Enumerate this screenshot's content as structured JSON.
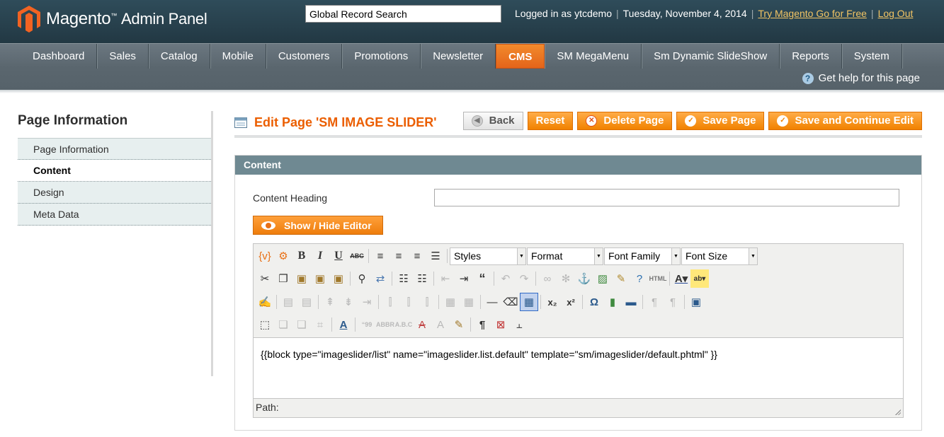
{
  "header": {
    "logo_text": "Magento",
    "logo_sub": "Admin Panel",
    "search_value": "Global Record Search",
    "logged_in": "Logged in as ytcdemo",
    "date": "Tuesday, November 4, 2014",
    "try_link": "Try Magento Go for Free",
    "logout_link": "Log Out"
  },
  "nav": {
    "items": [
      "Dashboard",
      "Sales",
      "Catalog",
      "Mobile",
      "Customers",
      "Promotions",
      "Newsletter",
      "CMS",
      "SM MegaMenu",
      "Sm Dynamic SlideShow",
      "Reports",
      "System"
    ],
    "active": "CMS",
    "help": "Get help for this page"
  },
  "sidebar": {
    "title": "Page Information",
    "tabs": [
      "Page Information",
      "Content",
      "Design",
      "Meta Data"
    ],
    "active_tab": "Content"
  },
  "page": {
    "title": "Edit Page 'SM IMAGE SLIDER'",
    "buttons": {
      "back": "Back",
      "reset": "Reset",
      "delete": "Delete Page",
      "save": "Save Page",
      "save_continue": "Save and Continue Edit"
    }
  },
  "content_section": {
    "header": "Content",
    "heading_label": "Content Heading",
    "heading_value": "",
    "show_hide": "Show / Hide Editor",
    "dropdowns": {
      "styles": "Styles",
      "format": "Format",
      "font_family": "Font Family",
      "font_size": "Font Size"
    },
    "editor_text": "{{block type=\"imageslider/list\" name=\"imageslider.list.default\" template=\"sm/imageslider/default.phtml\" }}",
    "path_label": "Path:"
  },
  "colors": {
    "accent": "#eb5e00",
    "header_bg": "#2f4c5a",
    "nav_bg": "#5a666e",
    "section_head": "#6f8992"
  }
}
